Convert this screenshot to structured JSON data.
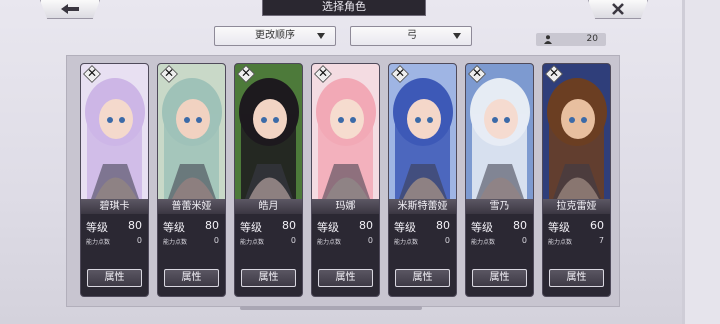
{
  "header": {
    "title": "选择角色"
  },
  "controls": {
    "sort_label": "更改顺序",
    "filter_label": "弓",
    "count": "20"
  },
  "card_labels": {
    "level": "等级",
    "capacity": "能力点数",
    "attribute_button": "属性"
  },
  "characters": [
    {
      "name": "碧琪卡",
      "level": "80",
      "points": "0",
      "hair": "#cdb6e6",
      "bg": "#e8e0f2",
      "skin": "#f4d9cc"
    },
    {
      "name": "普蕾米娅",
      "level": "80",
      "points": "0",
      "hair": "#9fc2b8",
      "bg": "#c9d9c8",
      "skin": "#f1d2c1"
    },
    {
      "name": "皓月",
      "level": "80",
      "points": "0",
      "hair": "#1d1a1e",
      "bg": "#4d7a3a",
      "skin": "#f2d4c4"
    },
    {
      "name": "玛娜",
      "level": "80",
      "points": "0",
      "hair": "#f2a9b6",
      "bg": "#f4dce2",
      "skin": "#f6dccf"
    },
    {
      "name": "米斯特蕾娅",
      "level": "80",
      "points": "0",
      "hair": "#3d59b7",
      "bg": "#9fb5e4",
      "skin": "#f4d7c9"
    },
    {
      "name": "雪乃",
      "level": "80",
      "points": "0",
      "hair": "#e6ecf4",
      "bg": "#7d9ad0",
      "skin": "#f5dbd0"
    },
    {
      "name": "拉克雷娅",
      "level": "60",
      "points": "7",
      "hair": "#6b3e22",
      "bg": "#2f3e7a",
      "skin": "#e8bf9f"
    }
  ]
}
